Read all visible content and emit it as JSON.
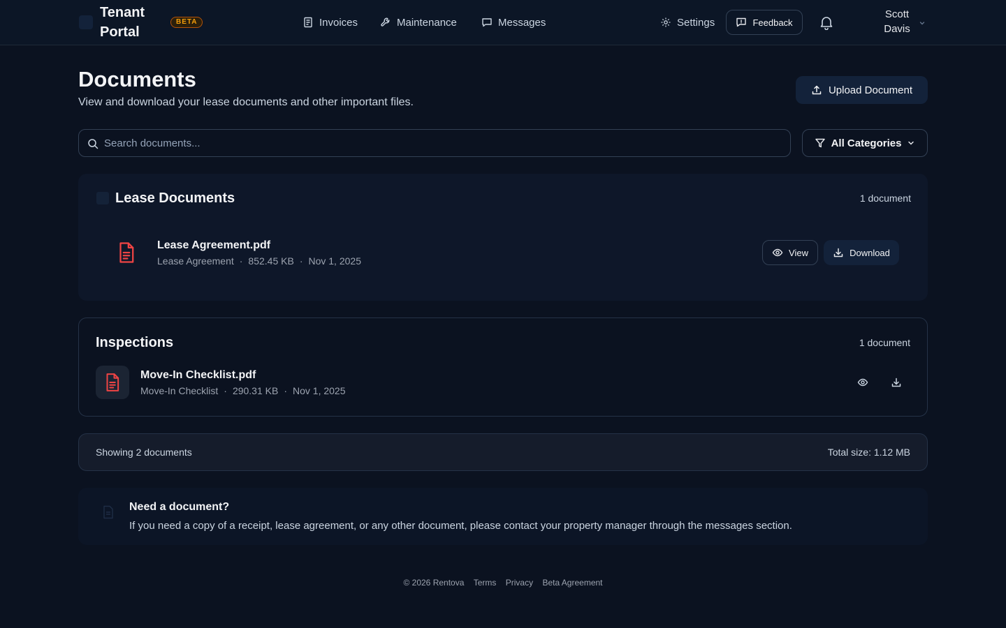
{
  "header": {
    "brand": "Tenant Portal",
    "beta": "BETA",
    "nav": [
      {
        "label": "Invoices",
        "icon": "receipt-icon"
      },
      {
        "label": "Maintenance",
        "icon": "wrench-icon"
      },
      {
        "label": "Messages",
        "icon": "message-icon"
      },
      {
        "label": "Settings",
        "icon": "gear-icon"
      }
    ],
    "feedback_label": "Feedback",
    "user_name": "Scott Davis"
  },
  "page": {
    "title": "Documents",
    "subtitle": "View and download your lease documents and other important files.",
    "upload_label": "Upload Document"
  },
  "search": {
    "placeholder": "Search documents...",
    "value": ""
  },
  "filter": {
    "label": "All Categories"
  },
  "sections": [
    {
      "title": "Lease Documents",
      "count": "1 document",
      "file": {
        "name": "Lease Agreement.pdf",
        "category": "Lease Agreement",
        "size": "852.45 KB",
        "date": "Nov 1, 2025"
      },
      "view_label": "View",
      "download_label": "Download"
    },
    {
      "title": "Inspections",
      "count": "1 document",
      "file": {
        "name": "Move-In Checklist.pdf",
        "category": "Move-In Checklist",
        "size": "290.31 KB",
        "date": "Nov 1, 2025"
      }
    }
  ],
  "summary": {
    "showing": "Showing 2 documents",
    "total": "Total size: 1.12 MB"
  },
  "info": {
    "title": "Need a document?",
    "text": "If you need a copy of a receipt, lease agreement, or any other document, please contact your property manager through the messages section."
  },
  "footer": {
    "copyright": "© 2026 Rentova",
    "links": [
      "Terms",
      "Privacy",
      "Beta Agreement"
    ]
  },
  "colors": {
    "background": "#0b1220",
    "pdf_red": "#ef4444",
    "beta_amber": "#f59e0b"
  }
}
